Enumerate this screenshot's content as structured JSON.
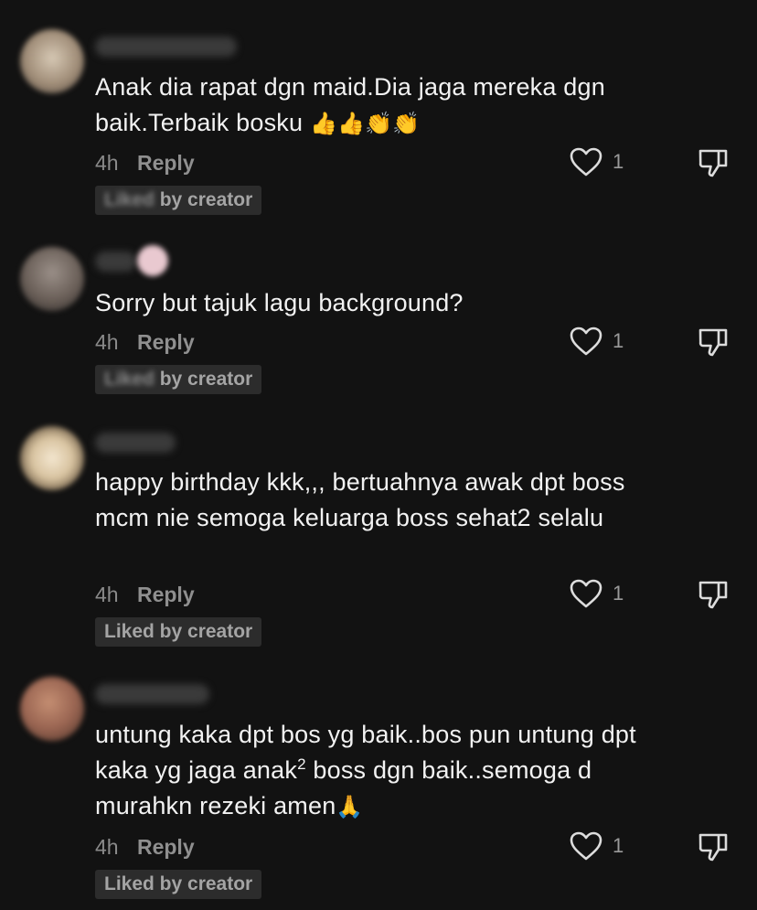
{
  "comments": [
    {
      "text": "Anak dia rapat dgn maid.Dia jaga mereka dgn baik.Terbaik bosku",
      "emoji": "👍👍👏👏",
      "time": "4h",
      "reply_label": "Reply",
      "likes": "1",
      "badge_prefix": "Liked",
      "badge_rest": " by creator"
    },
    {
      "text": "Sorry but tajuk lagu background?",
      "time": "4h",
      "reply_label": "Reply",
      "likes": "1",
      "badge_prefix": "Liked",
      "badge_rest": " by creator"
    },
    {
      "text": "happy birthday kkk,,, bertuahnya awak dpt boss mcm nie semoga keluarga boss sehat2 selalu",
      "time": "4h",
      "reply_label": "Reply",
      "likes": "1",
      "badge": "Liked by creator"
    },
    {
      "text_before": "untung kaka dpt bos yg baik..bos pun untung dpt kaka yg jaga anak",
      "text_sup": "2",
      "text_after": " boss dgn baik..semoga d murahkn rezeki amen",
      "emoji": "🙏",
      "time": "4h",
      "reply_label": "Reply",
      "likes": "1",
      "badge": "Liked by creator"
    }
  ],
  "colors": {
    "background": "#121212",
    "text": "#f2f2f2",
    "meta": "#8a8a8a",
    "badge_bg": "#2c2c2c"
  },
  "icons": {
    "like": "heart-outline-icon",
    "dislike": "thumbs-down-icon"
  }
}
